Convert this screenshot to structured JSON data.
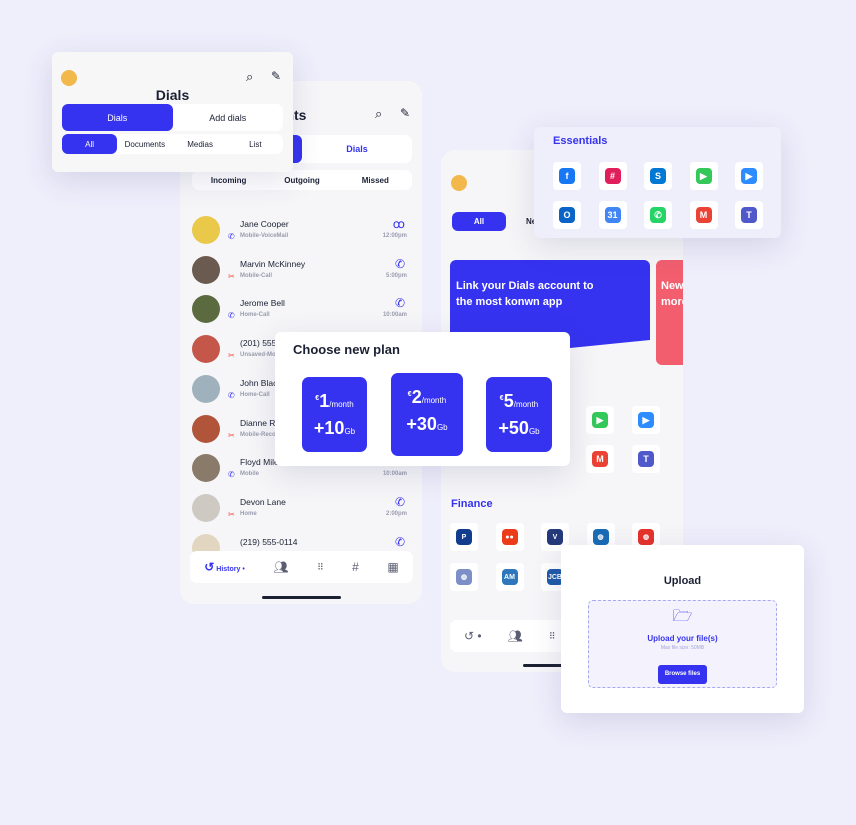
{
  "colors": {
    "accent": "#3533ef",
    "missed": "#f0413b",
    "background": "#efeefb"
  },
  "recents": {
    "title": "Recents",
    "tabs": [
      "",
      "Dials"
    ],
    "filters": [
      "Incoming",
      "Outgoing",
      "Missed"
    ],
    "calls": [
      {
        "name": "Jane Cooper",
        "type": "Mobile-VoiceMail",
        "time": "12:00pm",
        "missed": false,
        "icon": "voicemail-icon",
        "avatar": "#e9c84a"
      },
      {
        "name": "Marvin McKinney",
        "type": "Mobile-Call",
        "time": "5:00pm",
        "missed": true,
        "icon": "phone-icon",
        "avatar": "#6a5a50"
      },
      {
        "name": "Jerome Bell",
        "type": "Home-Call",
        "time": "10:00am",
        "missed": false,
        "icon": "phone-icon",
        "avatar": "#5b6a3f"
      },
      {
        "name": "(201) 555-0124",
        "type": "Unsaved-Mobile",
        "time": "",
        "missed": true,
        "icon": "",
        "avatar": "#c4574a"
      },
      {
        "name": "John Black",
        "type": "Home-Call",
        "time": "",
        "missed": false,
        "icon": "",
        "avatar": "#9fb1bd"
      },
      {
        "name": "Dianne Russell",
        "type": "Mobile-Recorded",
        "time": "",
        "missed": true,
        "icon": "",
        "avatar": "#b0553a"
      },
      {
        "name": "Floyd Miles",
        "type": "Mobile",
        "time": "10:00am",
        "missed": false,
        "icon": "",
        "avatar": "#8a7a6a"
      },
      {
        "name": "Devon Lane",
        "type": "Home",
        "time": "2:00pm",
        "missed": true,
        "icon": "phone-icon",
        "avatar": "#cfc9c4"
      },
      {
        "name": "(219) 555-0114",
        "type": "",
        "time": "",
        "missed": false,
        "icon": "phone-icon",
        "avatar": "#e2d6c0"
      }
    ],
    "nav": {
      "history": "History"
    }
  },
  "dials": {
    "title": "Dials",
    "tabs": [
      "Dials",
      "Add dials"
    ],
    "filters": [
      "All",
      "Documents",
      "Medias",
      "List"
    ]
  },
  "apps": {
    "tabs": [
      "All",
      "New"
    ],
    "banner1": "Link your Dials account to the most konwn app",
    "banner2": "New more",
    "finance_title": "Finance"
  },
  "essentials": {
    "title": "Essentials",
    "icons": [
      {
        "name": "facebook-icon",
        "glyph": "f",
        "color": "#1877f2"
      },
      {
        "name": "slack-icon",
        "glyph": "#",
        "color": "#e01e5a"
      },
      {
        "name": "skype-icon",
        "glyph": "S",
        "color": "#0078d4"
      },
      {
        "name": "facetime-icon",
        "glyph": "▶",
        "color": "#34c759"
      },
      {
        "name": "zoom-icon",
        "glyph": "▶",
        "color": "#2d8cff"
      },
      {
        "name": "outlook-icon",
        "glyph": "O",
        "color": "#0a64c8"
      },
      {
        "name": "google-calendar-icon",
        "glyph": "31",
        "color": "#4285f4"
      },
      {
        "name": "whatsapp-icon",
        "glyph": "✆",
        "color": "#25d366"
      },
      {
        "name": "gmail-icon",
        "glyph": "M",
        "color": "#ea4335"
      },
      {
        "name": "teams-icon",
        "glyph": "T",
        "color": "#5059c9"
      }
    ]
  },
  "finance": {
    "icons": [
      {
        "name": "paypal-icon",
        "glyph": "P",
        "color": "#123d8f"
      },
      {
        "name": "mastercard-icon",
        "glyph": "●●",
        "color": "#eb3b1b"
      },
      {
        "name": "venmo-icon",
        "glyph": "V",
        "color": "#253a7a"
      },
      {
        "name": "webmoney-icon",
        "glyph": "◍",
        "color": "#1a6bb5"
      },
      {
        "name": "globe-red-icon",
        "glyph": "◍",
        "color": "#e6322a"
      },
      {
        "name": "globe-icon",
        "glyph": "◍",
        "color": "#7c8fc6"
      },
      {
        "name": "amex-icon",
        "glyph": "AM",
        "color": "#2e77bc"
      },
      {
        "name": "jcb-icon",
        "glyph": "JCB",
        "color": "#1f5aa8"
      }
    ]
  },
  "plans": {
    "title": "Choose new plan",
    "items": [
      {
        "currency": "€",
        "price": "1",
        "period": "/month",
        "data": "+10",
        "unit": "Gb"
      },
      {
        "currency": "€",
        "price": "2",
        "period": "/month",
        "data": "+30",
        "unit": "Gb"
      },
      {
        "currency": "€",
        "price": "5",
        "period": "/month",
        "data": "+50",
        "unit": "Gb"
      }
    ]
  },
  "upload": {
    "title": "Upload",
    "prompt": "Upload your file(s)",
    "hint": "Max file size: 50MB",
    "button": "Browse files"
  }
}
